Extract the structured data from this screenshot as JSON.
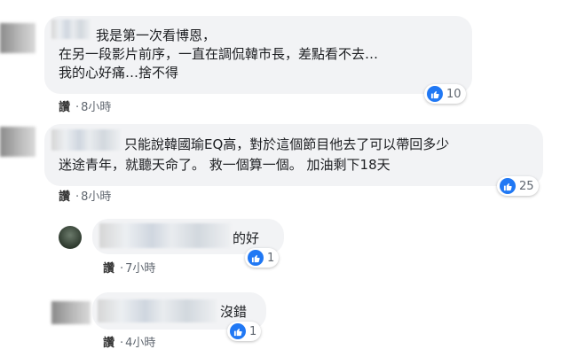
{
  "comments": [
    {
      "lines": [
        "我是第一次看博恩，",
        "在另一段影片前序，一直在調侃韓市長，差點看不去…",
        "我的心好痛…捨不得"
      ],
      "like_label": "讚",
      "time": "8小時",
      "reaction_count": "10"
    },
    {
      "lines": [
        "只能說韓國瑜EQ高，對於這個節目他去了可以帶回多少",
        "迷途青年，就聽天命了。 救一個算一個。 加油剩下18天"
      ],
      "like_label": "讚",
      "time": "8小時",
      "reaction_count": "25"
    },
    {
      "lines": [
        "的好"
      ],
      "like_label": "讚",
      "time": "7小時",
      "reaction_count": "1"
    },
    {
      "lines": [
        "沒錯"
      ],
      "like_label": "讚",
      "time": "4小時",
      "reaction_count": "1"
    }
  ],
  "icons": {
    "like_reaction": "thumbs-up-icon"
  },
  "colors": {
    "like_blue": "#2078f4",
    "bubble_bg": "#f2f3f5"
  }
}
